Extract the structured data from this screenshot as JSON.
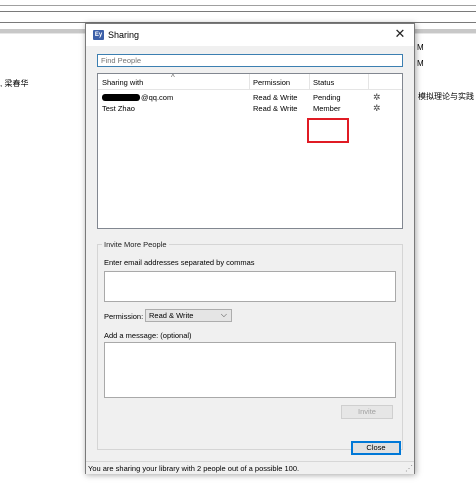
{
  "background": {
    "right_top_1": "M",
    "right_top_2": "M",
    "left_fragment": ", 梁春华",
    "right_fragment": "模拟理论与实践"
  },
  "dialog": {
    "icon_text": "Ey",
    "title": "Sharing",
    "close_glyph": "✕",
    "search": {
      "placeholder": "Find People",
      "value": ""
    },
    "list": {
      "columns": [
        "Sharing with",
        "Permission",
        "Status"
      ],
      "rows": [
        {
          "name": "@qq.com",
          "name_redacted": true,
          "permission": "Read & Write",
          "status": "Pending"
        },
        {
          "name": "Test Zhao",
          "name_redacted": false,
          "permission": "Read & Write",
          "status": "Member"
        }
      ],
      "highlight_color": "#e01b24"
    },
    "invite": {
      "group_label": "Invite More People",
      "email_label": "Enter email addresses separated by commas",
      "email_value": "",
      "permission_label": "Permission:",
      "permission_value": "Read & Write",
      "message_label": "Add a message: (optional)",
      "message_value": "",
      "invite_button": "Invite"
    },
    "close_button": "Close",
    "status_text": "You are sharing your library with 2 people out of a possible 100."
  }
}
